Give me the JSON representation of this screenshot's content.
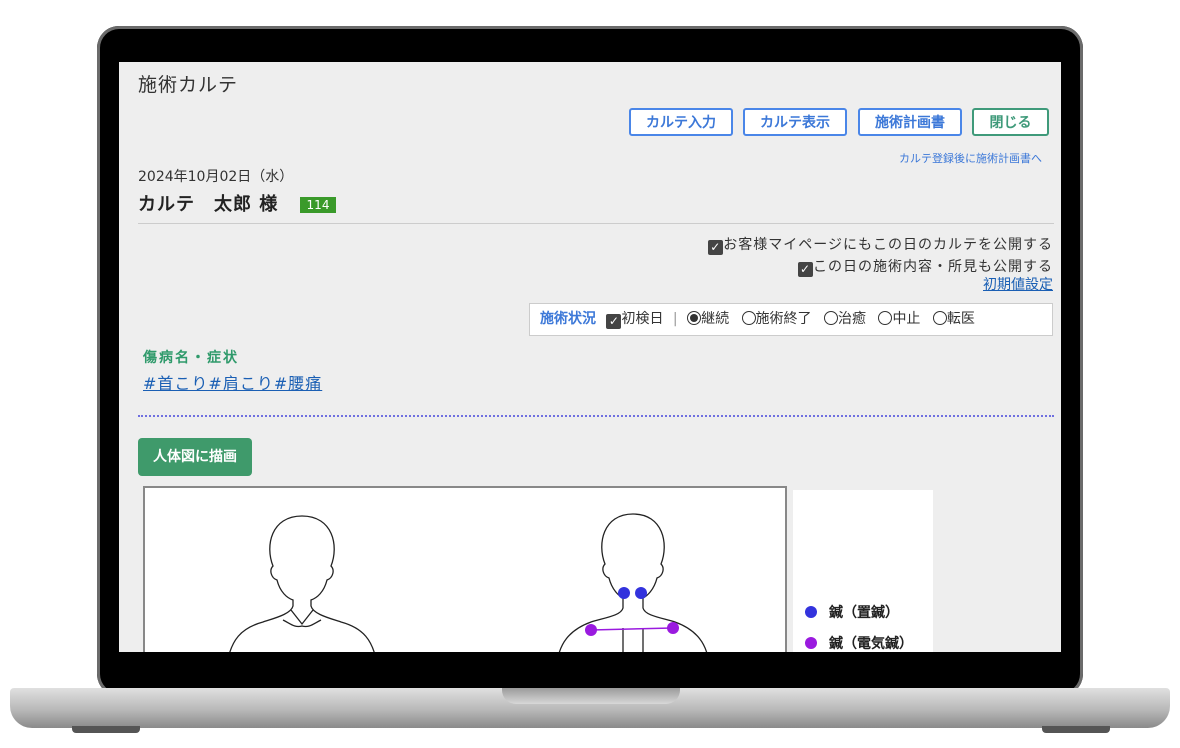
{
  "app": {
    "title": "施術カルテ"
  },
  "toolbar": {
    "karte_input": "カルテ入力",
    "karte_view": "カルテ表示",
    "plan": "施術計画書",
    "close": "閉じる",
    "hint": "カルテ登録後に施術計画書へ"
  },
  "record": {
    "date": "2024年10月02日（水）",
    "patient_name": "カルテ　太郎 様",
    "patient_no": "114"
  },
  "publish": {
    "mypage": "お客様マイページにもこの日のカルテを公開する",
    "findings": "この日の施術内容・所見も公開する",
    "reset_link": "初期値設定"
  },
  "status": {
    "label": "施術状況",
    "first_visit": "初検日",
    "separator": "|",
    "options": [
      "継続",
      "施術終了",
      "治癒",
      "中止",
      "転医"
    ],
    "selected": "継続"
  },
  "diagnosis": {
    "heading": "傷病名・症状",
    "tags": "#首こり#肩こり#腰痛"
  },
  "body_chart": {
    "draw_button": "人体図に描画",
    "legend": [
      {
        "label": "鍼（置鍼）",
        "color": "#3333dd"
      },
      {
        "label": "鍼（電気鍼）",
        "color": "#9a1adf"
      }
    ]
  }
}
